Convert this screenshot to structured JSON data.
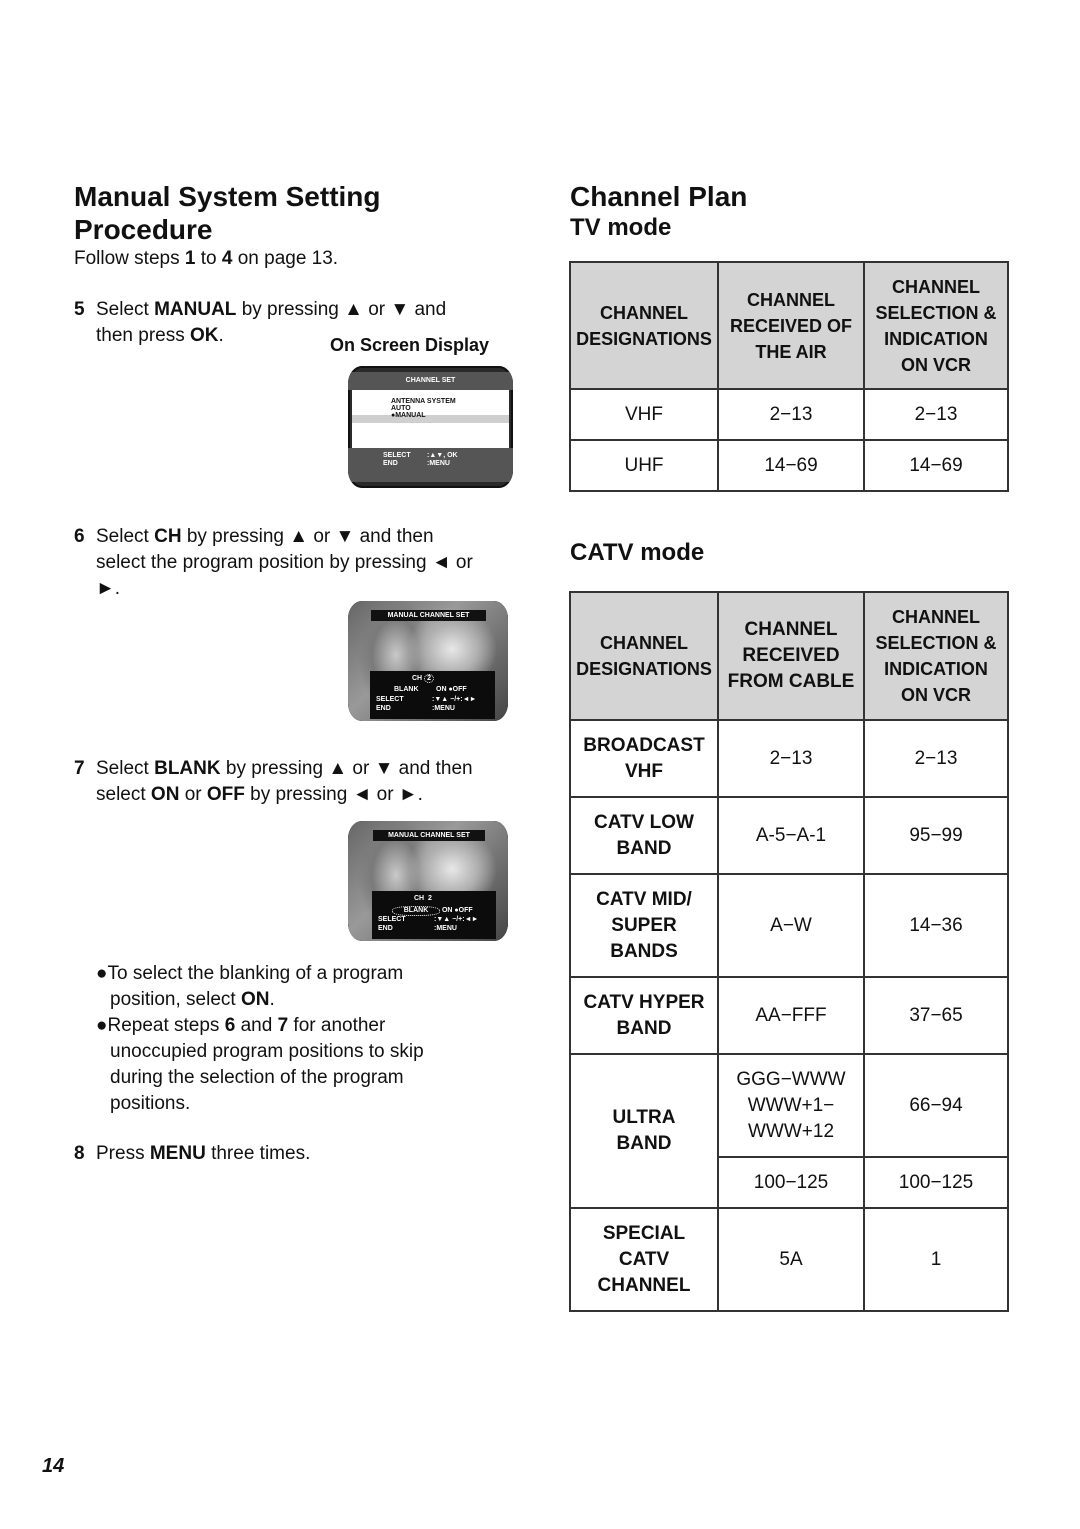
{
  "left": {
    "title_line1": "Manual System Setting",
    "title_line2": "Procedure",
    "intro": {
      "pre": "Follow steps ",
      "a": "1",
      "mid": " to ",
      "b": "4",
      "post": " on page 13."
    },
    "step5": {
      "num": "5",
      "pre": "Select ",
      "k1": "MANUAL",
      "mid": " by pressing ▲ or ▼ and",
      "line2pre": "then press ",
      "k2": "OK",
      "line2post": "."
    },
    "osd_label": "On Screen Display",
    "osd1": {
      "title": "CHANNEL SET",
      "lines": [
        "ANTENNA SYSTEM",
        "AUTO",
        "●MANUAL"
      ],
      "footer": [
        [
          "SELECT",
          ":▲▼, OK"
        ],
        [
          "END",
          ":MENU"
        ]
      ]
    },
    "step6": {
      "num": "6",
      "pre": "Select ",
      "k1": "CH",
      "mid": " by pressing ▲ or ▼ and then",
      "line2": "select the program position by pressing ◄ or",
      "line3": "►."
    },
    "osd2": {
      "title": "MANUAL CHANNEL SET",
      "ch_label": "CH",
      "ch_value": "2",
      "blank_label": "BLANK",
      "blank_on": "ON",
      "blank_off": "●OFF",
      "select_label": "SELECT",
      "select_value": ":▼▲   −/+:◄►",
      "end_label": "END",
      "end_value": ":MENU"
    },
    "step7": {
      "num": "7",
      "pre": "Select ",
      "k1": "BLANK",
      "mid": " by pressing ▲ or ▼ and then",
      "line2pre": "select ",
      "k2": "ON",
      "line2mid": " or ",
      "k3": "OFF",
      "line2post": " by pressing ◄ or ►."
    },
    "osd3": {
      "title": "MANUAL CHANNEL SET",
      "ch_label": "CH",
      "ch_value": "2",
      "blank_label": "BLANK",
      "blank_on": "ON",
      "blank_off": "●OFF",
      "select_label": "SELECT",
      "select_value": ":▼▲   −/+:◄►",
      "end_label": "END",
      "end_value": ":MENU"
    },
    "bullet1": {
      "line1": "●To select the blanking of a program",
      "line2pre": "position, select ",
      "k": "ON",
      "line2post": "."
    },
    "bullet2": {
      "pre": "●Repeat steps ",
      "a": "6",
      "mid": " and ",
      "b": "7",
      "post": " for another",
      "line2": "unoccupied program positions to skip",
      "line3": "during the selection of the program",
      "line4": "positions."
    },
    "step8": {
      "num": "8",
      "pre": "Press ",
      "k": "MENU",
      "post": " three times."
    }
  },
  "right": {
    "title": "Channel Plan",
    "tv_mode": {
      "heading": "TV mode",
      "headers": [
        "CHANNEL\nDESIGNATIONS",
        "CHANNEL\nRECEIVED OF\nTHE AIR",
        "CHANNEL\nSELECTION &\nINDICATION\nON VCR"
      ],
      "rows": [
        [
          "VHF",
          "2−13",
          "2−13"
        ],
        [
          "UHF",
          "14−69",
          "14−69"
        ]
      ]
    },
    "catv_mode": {
      "heading": "CATV mode",
      "headers": [
        "CHANNEL\nDESIGNATIONS",
        "CHANNEL\nRECEIVED\nFROM CABLE",
        "CHANNEL\nSELECTION &\nINDICATION\nON VCR"
      ],
      "rows": [
        {
          "label": "BROADCAST\nVHF",
          "received": "2−13",
          "vcr": "2−13"
        },
        {
          "label": "CATV LOW\nBAND",
          "received": "A-5−A-1",
          "vcr": "95−99"
        },
        {
          "label": "CATV MID/\nSUPER\nBANDS",
          "received": "A−W",
          "vcr": "14−36"
        },
        {
          "label": "CATV HYPER\nBAND",
          "received": "AA−FFF",
          "vcr": "37−65"
        },
        {
          "label": "ULTRA\nBAND",
          "received": "GGG−WWW\nWWW+1−\nWWW+12",
          "vcr": "66−94",
          "received2": "100−125",
          "vcr2": "100−125"
        },
        {
          "label": "SPECIAL\nCATV\nCHANNEL",
          "received": "5A",
          "vcr": "1"
        }
      ]
    }
  },
  "page_number": "14"
}
